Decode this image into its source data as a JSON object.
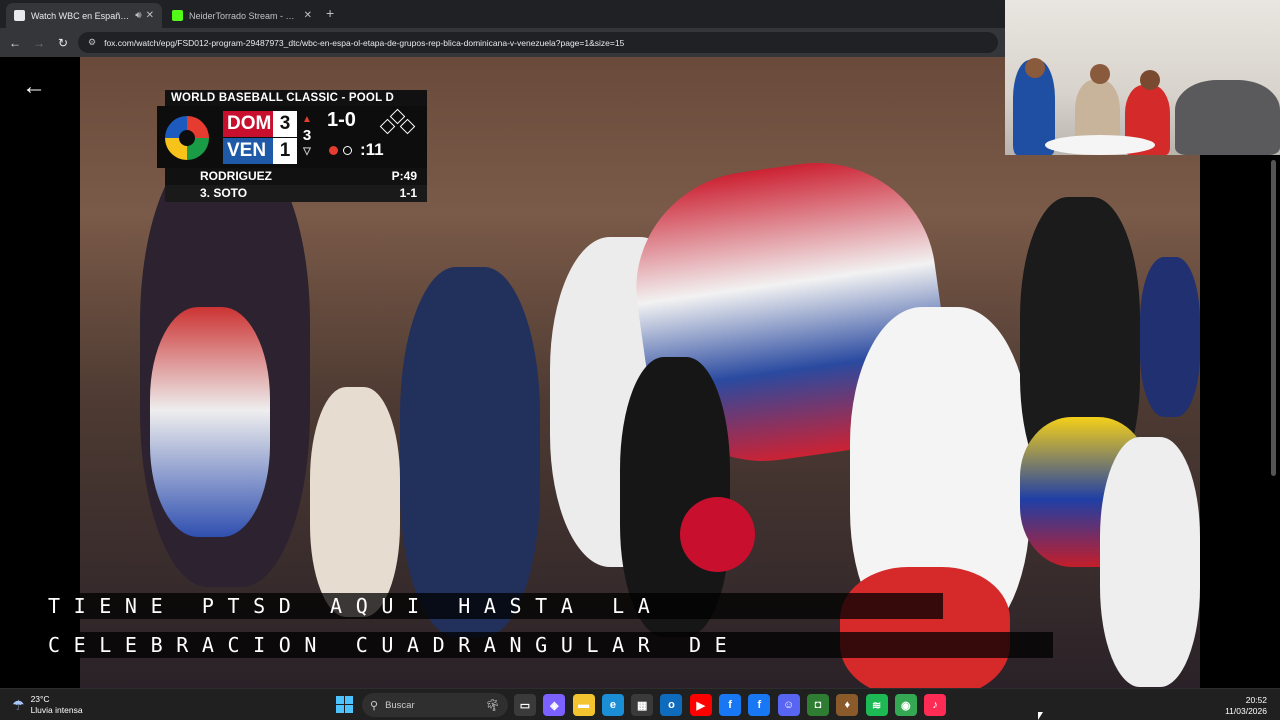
{
  "browser": {
    "tabs": [
      {
        "title": "Watch WBC en Español - E",
        "favicon_color": "#e8eaed",
        "audio_icon": "speaker-icon",
        "close": "✕"
      },
      {
        "title": "NeiderTorrado Stream - Watch",
        "favicon_color": "#53fc18",
        "close": "✕"
      }
    ],
    "new_tab": "+",
    "url": "fox.com/watch/epg/FSD012-program-29487973_dtc/wbc-en-espa-ol-etapa-de-grupos-rep-blica-dominicana-v-venezuela?page=1&size=15"
  },
  "scoreboard": {
    "title": "WORLD BASEBALL CLASSIC - POOL D",
    "home": {
      "abbr": "DOM",
      "runs": "3",
      "color": "#c8102e"
    },
    "away": {
      "abbr": "VEN",
      "runs": "1",
      "color": "#1e5aa8"
    },
    "inning": "3",
    "count": "1-0",
    "pitch_clock": ":11",
    "pitcher": {
      "name": "RODRIGUEZ",
      "stat": "P:49"
    },
    "batter": {
      "name": "3. SOTO",
      "stat": "1-1"
    }
  },
  "captions": {
    "line1": "TIENE PTSD AQUI HASTA LA",
    "line2": "CELEBRACION CUADRANGULAR DE"
  },
  "taskbar": {
    "weather_temp": "23°C",
    "weather_desc": "Lluvia intensa",
    "search_placeholder": "Buscar",
    "time": "20:52",
    "date": "11/03/2026",
    "apps": [
      {
        "name": "task-view-icon",
        "color": "#3a3a3a",
        "glyph": "▭"
      },
      {
        "name": "copilot-icon",
        "color": "#7b61ff",
        "glyph": "◈"
      },
      {
        "name": "file-explorer-icon",
        "color": "#f4c430",
        "glyph": "▬"
      },
      {
        "name": "edge-icon",
        "color": "#1b8fd6",
        "glyph": "e"
      },
      {
        "name": "store-icon",
        "color": "#3a3a3a",
        "glyph": "▦"
      },
      {
        "name": "outlook-icon",
        "color": "#0f6cbd",
        "glyph": "o"
      },
      {
        "name": "youtube-icon",
        "color": "#ff0000",
        "glyph": "▶"
      },
      {
        "name": "facebook-icon",
        "color": "#1877f2",
        "glyph": "f"
      },
      {
        "name": "facebook-alt-icon",
        "color": "#1877f2",
        "glyph": "f"
      },
      {
        "name": "discord-icon",
        "color": "#5865f2",
        "glyph": "☺"
      },
      {
        "name": "game-icon",
        "color": "#2e7d32",
        "glyph": "◘"
      },
      {
        "name": "app-icon",
        "color": "#8a5a2b",
        "glyph": "♦"
      },
      {
        "name": "spotify-icon",
        "color": "#1db954",
        "glyph": "≋"
      },
      {
        "name": "chrome-icon",
        "color": "#34a853",
        "glyph": "◉"
      },
      {
        "name": "tiktok-icon",
        "color": "#fe2c55",
        "glyph": "♪"
      }
    ]
  }
}
